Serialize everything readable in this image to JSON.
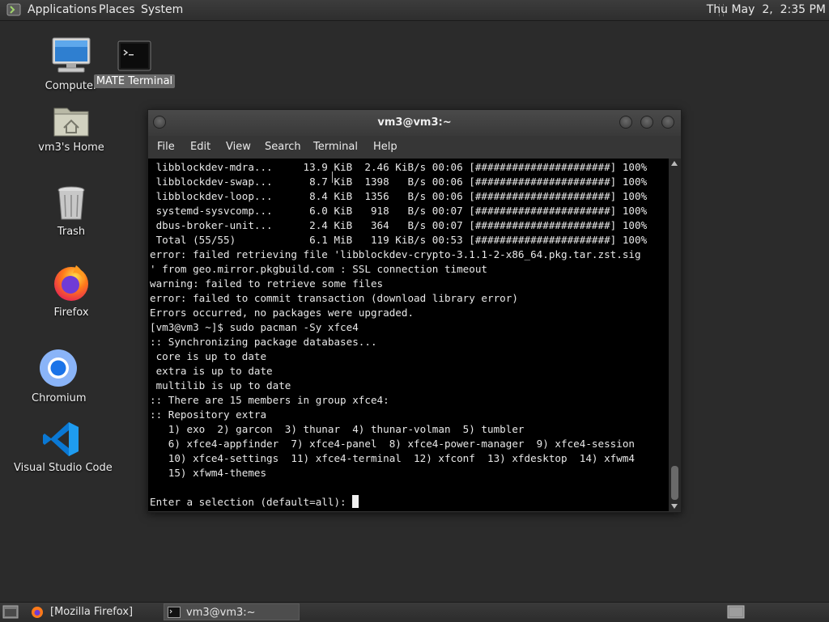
{
  "top_panel": {
    "menus": [
      "Applications",
      "Places",
      "System"
    ],
    "clock": "Thu May  2,  2:35 PM"
  },
  "desktop_icons": [
    {
      "label": "Computer",
      "icon": "computer-icon"
    },
    {
      "label": "MATE Terminal",
      "icon": "terminal-icon"
    },
    {
      "label": "vm3's Home",
      "icon": "home-folder-icon"
    },
    {
      "label": "Trash",
      "icon": "trash-icon"
    },
    {
      "label": "Firefox",
      "icon": "firefox-icon"
    },
    {
      "label": "Chromium",
      "icon": "chromium-icon"
    },
    {
      "label": "Visual Studio Code",
      "icon": "vscode-icon"
    }
  ],
  "terminal": {
    "title": "vm3@vm3:~",
    "menus": [
      "File",
      "Edit",
      "View",
      "Search",
      "Terminal",
      "Help"
    ],
    "lines": [
      " libblockdev-mdra...     13.9 KiB  2.46 KiB/s 00:06 [######################] 100%",
      " libblockdev-swap...      8.7 KiB  1398   B/s 00:06 [######################] 100%",
      " libblockdev-loop...      8.4 KiB  1356   B/s 00:06 [######################] 100%",
      " systemd-sysvcomp...      6.0 KiB   918   B/s 00:07 [######################] 100%",
      " dbus-broker-unit...      2.4 KiB   364   B/s 00:07 [######################] 100%",
      " Total (55/55)            6.1 MiB   119 KiB/s 00:53 [######################] 100%",
      "error: failed retrieving file 'libblockdev-crypto-3.1.1-2-x86_64.pkg.tar.zst.sig",
      "' from geo.mirror.pkgbuild.com : SSL connection timeout",
      "warning: failed to retrieve some files",
      "error: failed to commit transaction (download library error)",
      "Errors occurred, no packages were upgraded.",
      "[vm3@vm3 ~]$ sudo pacman -Sy xfce4",
      ":: Synchronizing package databases...",
      " core is up to date",
      " extra is up to date",
      " multilib is up to date",
      ":: There are 15 members in group xfce4:",
      ":: Repository extra",
      "   1) exo  2) garcon  3) thunar  4) thunar-volman  5) tumbler",
      "   6) xfce4-appfinder  7) xfce4-panel  8) xfce4-power-manager  9) xfce4-session",
      "   10) xfce4-settings  11) xfce4-terminal  12) xfconf  13) xfdesktop  14) xfwm4",
      "   15) xfwm4-themes",
      ""
    ],
    "prompt": "Enter a selection (default=all): "
  },
  "taskbar": {
    "items": [
      {
        "label": "[Mozilla Firefox]",
        "icon": "firefox-icon"
      },
      {
        "label": "vm3@vm3:~",
        "icon": "terminal-icon"
      }
    ]
  }
}
